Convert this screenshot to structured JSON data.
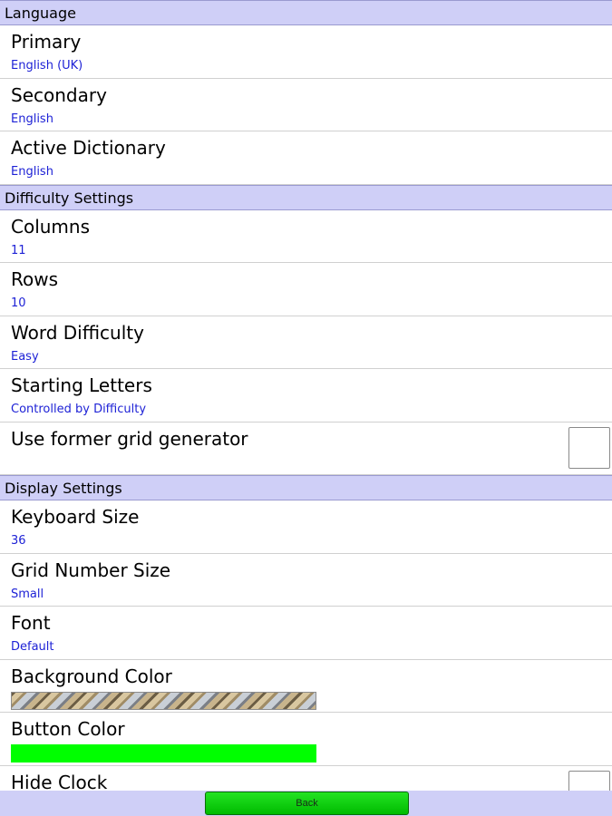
{
  "sections": {
    "language": {
      "header": "Language",
      "primary": {
        "title": "Primary",
        "value": "English (UK)"
      },
      "secondary": {
        "title": "Secondary",
        "value": "English"
      },
      "dictionary": {
        "title": "Active Dictionary",
        "value": "English"
      }
    },
    "difficulty": {
      "header": "Difficulty Settings",
      "columns": {
        "title": "Columns",
        "value": "11"
      },
      "rows": {
        "title": "Rows",
        "value": "10"
      },
      "word_difficulty": {
        "title": "Word Difficulty",
        "value": "Easy"
      },
      "starting_letters": {
        "title": "Starting Letters",
        "value": "Controlled by Difficulty"
      },
      "former_grid": {
        "title": "Use former grid generator",
        "checked": false
      }
    },
    "display": {
      "header": "Display Settings",
      "keyboard_size": {
        "title": "Keyboard Size",
        "value": "36"
      },
      "grid_number_size": {
        "title": "Grid Number Size",
        "value": "Small"
      },
      "font": {
        "title": "Font",
        "value": "Default"
      },
      "background_color": {
        "title": "Background Color",
        "pattern": "wood-metal-diagonal-stripes"
      },
      "button_color": {
        "title": "Button Color",
        "color": "#00ff00"
      },
      "hide_clock": {
        "title": "Hide Clock",
        "checked": false
      }
    }
  },
  "footer": {
    "back_label": "Back"
  },
  "colors": {
    "section_header_bg": "#cfcff7",
    "value_text": "#1e22d6",
    "back_button": "#00cc00"
  }
}
